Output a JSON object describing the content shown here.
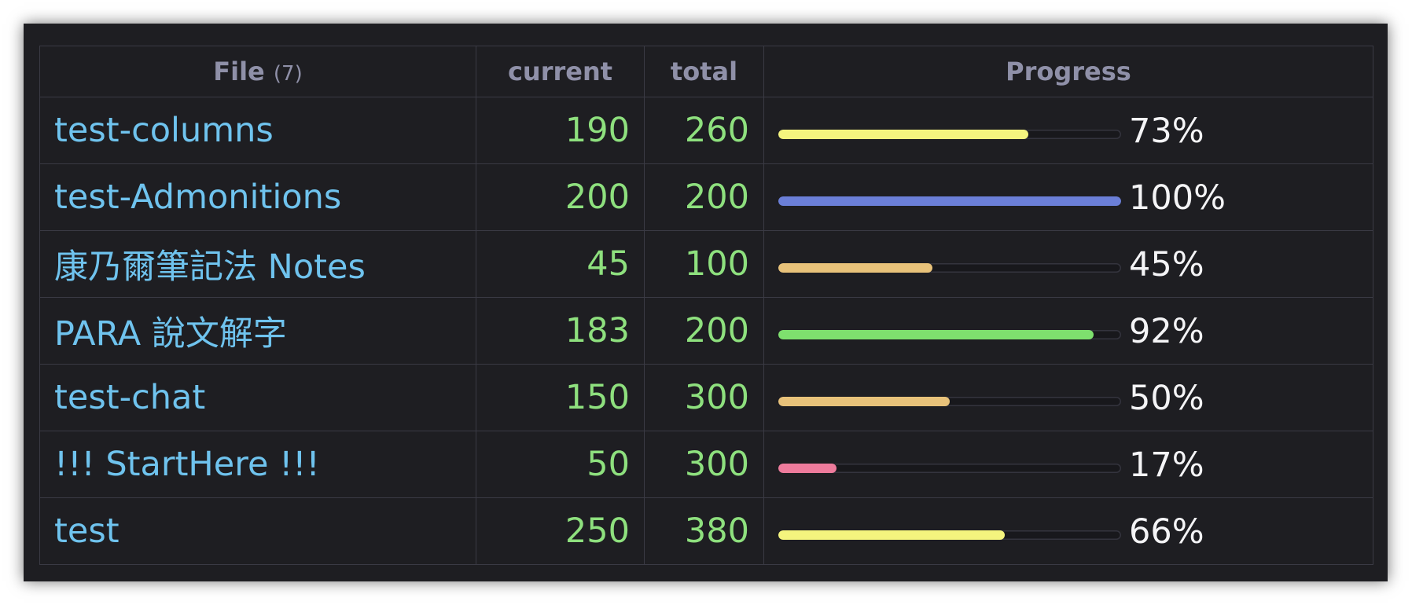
{
  "table": {
    "headers": {
      "file": "File",
      "file_count": "(7)",
      "current": "current",
      "total": "total",
      "progress": "Progress"
    },
    "rows": [
      {
        "file": "test-columns",
        "current": "190",
        "total": "260",
        "percent": "73%",
        "progress": 0.73,
        "color": "#f4f47e"
      },
      {
        "file": "test-Admonitions",
        "current": "200",
        "total": "200",
        "percent": "100%",
        "progress": 1.0,
        "color": "#6b7fd8"
      },
      {
        "file": "康乃爾筆記法 Notes",
        "current": "45",
        "total": "100",
        "percent": "45%",
        "progress": 0.45,
        "color": "#e8c27a"
      },
      {
        "file": "PARA 說文解字",
        "current": "183",
        "total": "200",
        "percent": "92%",
        "progress": 0.92,
        "color": "#7ee06e"
      },
      {
        "file": "test-chat",
        "current": "150",
        "total": "300",
        "percent": "50%",
        "progress": 0.5,
        "color": "#e8c27a"
      },
      {
        "file": "!!! StartHere !!!",
        "current": "50",
        "total": "300",
        "percent": "17%",
        "progress": 0.17,
        "color": "#ee7b9c"
      },
      {
        "file": "test",
        "current": "250",
        "total": "380",
        "percent": "66%",
        "progress": 0.66,
        "color": "#f4f47e"
      }
    ]
  }
}
